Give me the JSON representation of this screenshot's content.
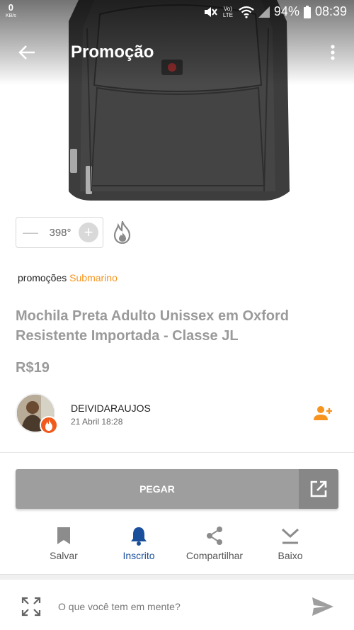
{
  "status_bar": {
    "speed_value": "0",
    "speed_unit": "KB/s",
    "network_label": "Vo) LTE",
    "battery": "94%",
    "time": "08:39"
  },
  "app_bar": {
    "title": "Promoção"
  },
  "temperature": {
    "value": "398°",
    "minus_label": "—",
    "plus_label": "+"
  },
  "store": {
    "prefix": "promoções",
    "name": "Submarino"
  },
  "product": {
    "title": "Mochila Preta Adulto Unissex em Oxford Resistente Importada - Classe JL",
    "price": "R$19"
  },
  "user": {
    "name": "DEIVIDARAUJOS",
    "date": "21 Abril 18:28"
  },
  "cta": {
    "label": "PEGAR"
  },
  "actions": [
    {
      "label": "Salvar",
      "icon": "bookmark-icon"
    },
    {
      "label": "Inscrito",
      "icon": "bell-icon"
    },
    {
      "label": "Compartilhar",
      "icon": "share-icon"
    },
    {
      "label": "Baixo",
      "icon": "down-icon"
    }
  ],
  "comment": {
    "placeholder": "O que você tem em mente?"
  },
  "colors": {
    "accent_orange": "#f7941d",
    "active_blue": "#1a4f9c",
    "button_gray": "#9e9e9e"
  }
}
